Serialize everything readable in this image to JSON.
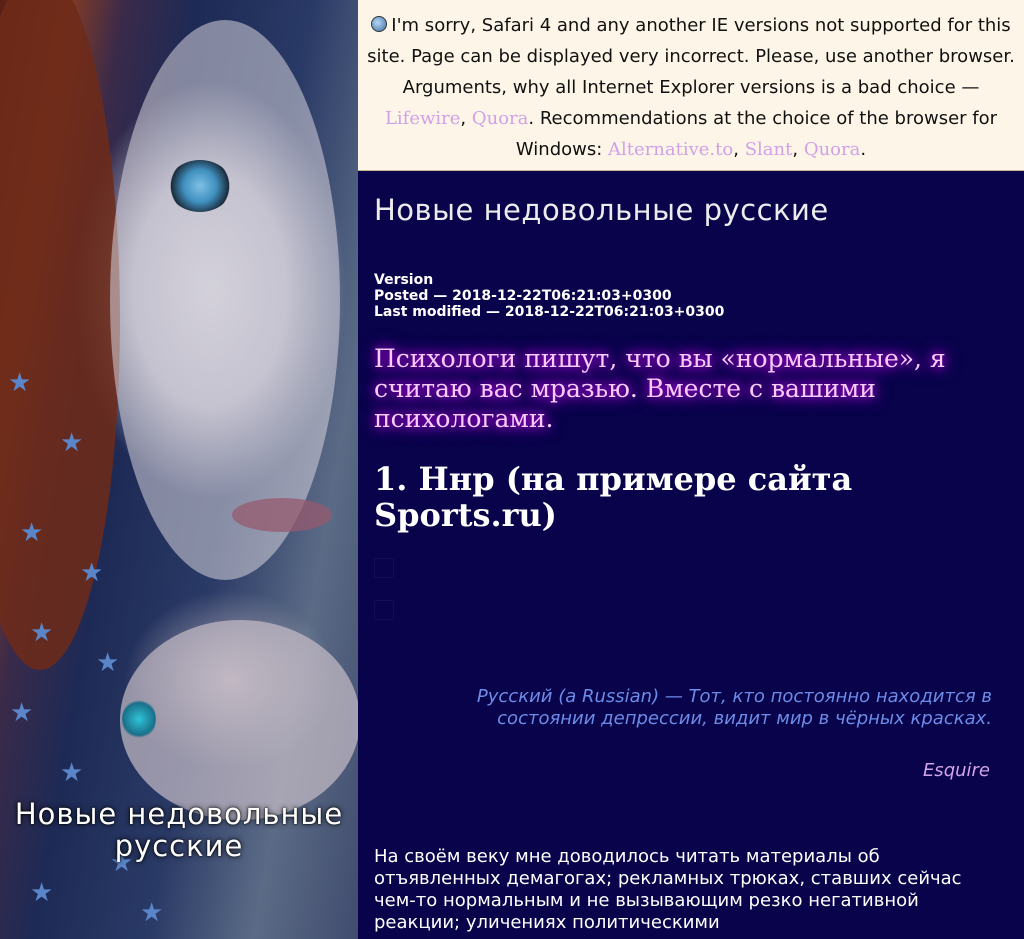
{
  "sidebar": {
    "title": "Новые недовольные русские"
  },
  "notice": {
    "text_before": "I'm sorry, Safari 4 and any another IE versions not supported for this site. Page can be displayed very incorrect. Please, use another browser. Arguments, why all Internet Explorer versions is a bad choice —",
    "link_lifewire": "Lifewire",
    "sep1": ",",
    "link_quora1": "Quora",
    "text_middle": ". Recommendations at the choice of the browser for Windows:",
    "link_alternative": "Alternative.to",
    "sep2": ",",
    "link_slant": "Slant",
    "sep3": ",",
    "link_quora2": "Quora",
    "text_end": "."
  },
  "article": {
    "title": "Новые недовольные русские",
    "version_label": "Version",
    "posted": "Posted — 2018-12-22T06:21:03+0300",
    "modified": "Last modified — 2018-12-22T06:21:03+0300",
    "lead": "Психологи пишут, что вы «нормальные», я считаю вас мразью. Вместе с вашими психологами.",
    "heading": "1. Ннр (на примере сайта Sports.ru)",
    "quote": "Русский (a Russian) — Тот, кто постоянно находится в состоянии депрессии, видит мир в чёрных красках.",
    "quote_source": "Esquire",
    "body": "На своём веку мне доводилось читать материалы об отъявленных демагогах; рекламных трюках, ставших сейчас чем-то нормальным и не вызывающим резко негативной реакции; уличениях политическими"
  },
  "colors": {
    "background": "#08034a",
    "notice_background": "#fdf6e8",
    "link": "#d1a0e6",
    "lead_glow": "#d400ff",
    "quote": "#6d8ce8"
  }
}
